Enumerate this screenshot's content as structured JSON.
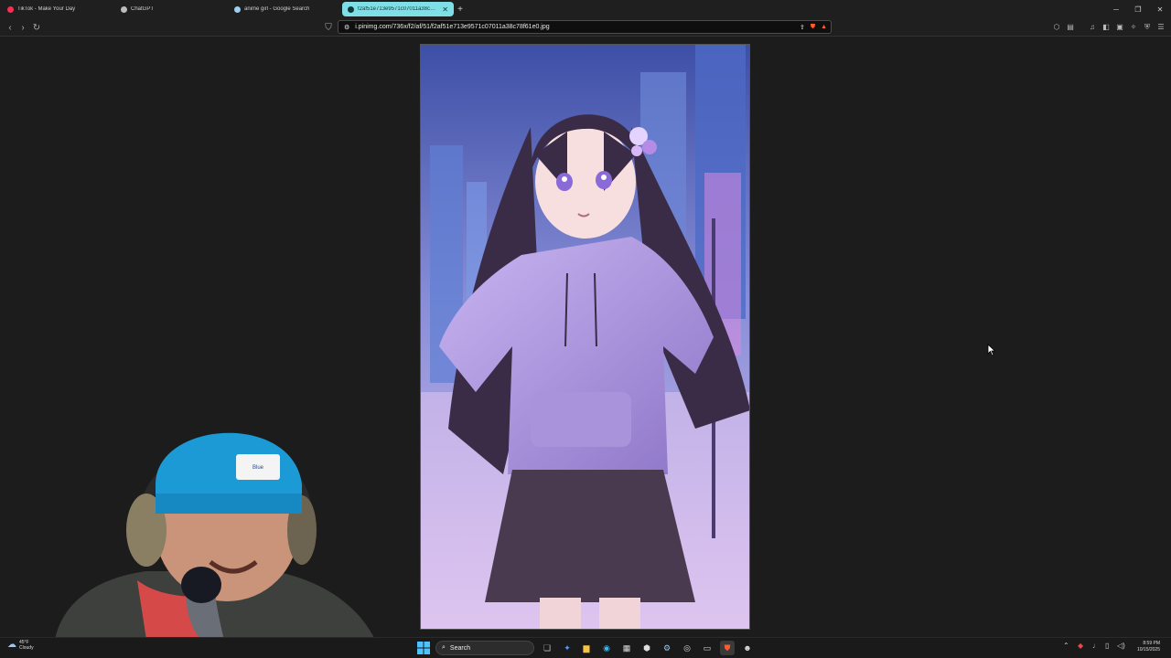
{
  "browser": {
    "tabs": [
      {
        "label": "TikTok - Make Your Day",
        "icon": "tiktok-icon",
        "color": "#ff2b55",
        "active": false
      },
      {
        "label": "ChatGPT",
        "icon": "chatgpt-icon",
        "color": "#bdbdbd",
        "active": false
      },
      {
        "label": "anime girl - Google Search",
        "icon": "google-icon",
        "color": "#9ad0f5",
        "active": false
      },
      {
        "label": "f2af51e713e9571c07011a38c78...",
        "icon": "globe-icon",
        "color": "#0e3a3e",
        "active": true
      }
    ],
    "new_tab_glyph": "+",
    "address": "i.pinimg.com/736x/f2/af/51/f2af51e713e9571c07011a38c78f61e0.jpg",
    "accent_color": "#7fdfe6"
  },
  "taskbar": {
    "weather_temp": "45°F",
    "weather_cond": "Cloudy",
    "search_label": "Search",
    "time": "8:59 PM",
    "date": "10/15/2025"
  },
  "webcam": {
    "beanie_badge": "Blue"
  }
}
